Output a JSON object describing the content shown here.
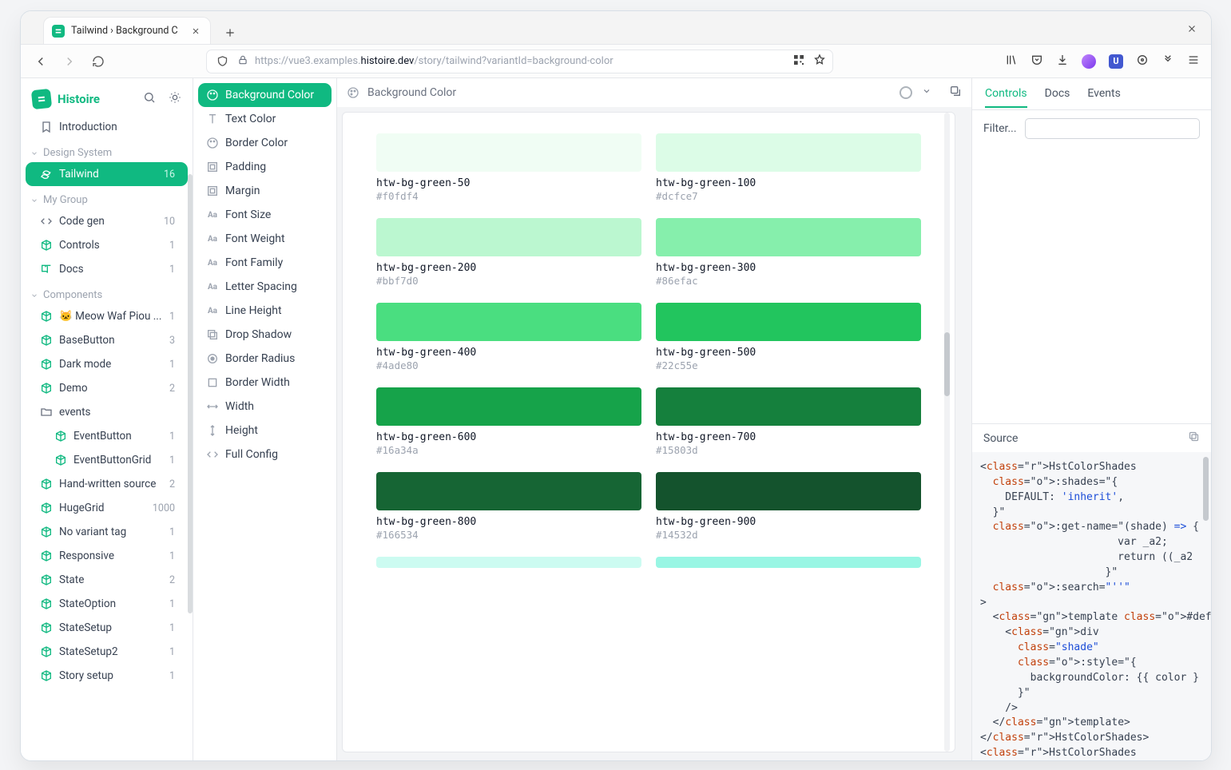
{
  "browser": {
    "tab_title": "Tailwind › Background C",
    "url_prefix": "https://vue3.examples.",
    "url_host": "histoire.dev",
    "url_path": "/story/tailwind?variantId=background-color"
  },
  "sidebar": {
    "brand": "Histoire",
    "intro": "Introduction",
    "groups": {
      "design": "Design System",
      "mygroup": "My Group",
      "components": "Components"
    },
    "design_items": [
      {
        "label": "Tailwind",
        "count": "16",
        "active": true
      }
    ],
    "mygroup_items": [
      {
        "label": "Code gen",
        "count": "10",
        "icon": "code"
      },
      {
        "label": "Controls",
        "count": "1",
        "icon": "cube"
      },
      {
        "label": "Docs",
        "count": "1",
        "icon": "book"
      }
    ],
    "components": [
      {
        "label": "🐱 Meow Waf Piou ...",
        "count": "1",
        "icon": "cube",
        "emoji": true
      },
      {
        "label": "BaseButton",
        "count": "3",
        "icon": "cube"
      },
      {
        "label": "Dark mode",
        "count": "1",
        "icon": "cube"
      },
      {
        "label": "Demo",
        "count": "2",
        "icon": "cube"
      },
      {
        "label": "events",
        "count": "",
        "icon": "folder",
        "folder": true
      },
      {
        "label": "EventButton",
        "count": "1",
        "icon": "cube",
        "indent": true
      },
      {
        "label": "EventButtonGrid",
        "count": "1",
        "icon": "cube",
        "indent": true
      },
      {
        "label": "Hand-written source",
        "count": "2",
        "icon": "cube"
      },
      {
        "label": "HugeGrid",
        "count": "1000",
        "icon": "cube"
      },
      {
        "label": "No variant tag",
        "count": "1",
        "icon": "cube"
      },
      {
        "label": "Responsive",
        "count": "1",
        "icon": "cube"
      },
      {
        "label": "State",
        "count": "2",
        "icon": "cube"
      },
      {
        "label": "StateOption",
        "count": "1",
        "icon": "cube"
      },
      {
        "label": "StateSetup",
        "count": "1",
        "icon": "cube"
      },
      {
        "label": "StateSetup2",
        "count": "1",
        "icon": "cube"
      },
      {
        "label": "Story setup",
        "count": "1",
        "icon": "cube"
      }
    ]
  },
  "variants": [
    {
      "label": "Background Color",
      "icon": "palette",
      "active": true
    },
    {
      "label": "Text Color",
      "icon": "text"
    },
    {
      "label": "Border Color",
      "icon": "palette"
    },
    {
      "label": "Padding",
      "icon": "box"
    },
    {
      "label": "Margin",
      "icon": "box"
    },
    {
      "label": "Font Size",
      "icon": "aa"
    },
    {
      "label": "Font Weight",
      "icon": "aa"
    },
    {
      "label": "Font Family",
      "icon": "aa"
    },
    {
      "label": "Letter Spacing",
      "icon": "aa"
    },
    {
      "label": "Line Height",
      "icon": "aa"
    },
    {
      "label": "Drop Shadow",
      "icon": "shadow"
    },
    {
      "label": "Border Radius",
      "icon": "circle"
    },
    {
      "label": "Border Width",
      "icon": "square"
    },
    {
      "label": "Width",
      "icon": "harrow"
    },
    {
      "label": "Height",
      "icon": "varrow"
    },
    {
      "label": "Full Config",
      "icon": "code"
    }
  ],
  "crumb": {
    "title": "Background Color"
  },
  "swatches": [
    {
      "name": "htw-bg-green-50",
      "hex": "#f0fdf4",
      "color": "#f0fdf4"
    },
    {
      "name": "htw-bg-green-100",
      "hex": "#dcfce7",
      "color": "#dcfce7"
    },
    {
      "name": "htw-bg-green-200",
      "hex": "#bbf7d0",
      "color": "#bbf7d0"
    },
    {
      "name": "htw-bg-green-300",
      "hex": "#86efac",
      "color": "#86efac"
    },
    {
      "name": "htw-bg-green-400",
      "hex": "#4ade80",
      "color": "#4ade80"
    },
    {
      "name": "htw-bg-green-500",
      "hex": "#22c55e",
      "color": "#22c55e"
    },
    {
      "name": "htw-bg-green-600",
      "hex": "#16a34a",
      "color": "#16a34a"
    },
    {
      "name": "htw-bg-green-700",
      "hex": "#15803d",
      "color": "#15803d"
    },
    {
      "name": "htw-bg-green-800",
      "hex": "#166534",
      "color": "#166534"
    },
    {
      "name": "htw-bg-green-900",
      "hex": "#14532d",
      "color": "#14532d"
    }
  ],
  "rpanel": {
    "tabs": {
      "controls": "Controls",
      "docs": "Docs",
      "events": "Events"
    },
    "filter_label": "Filter...",
    "filter_value": "",
    "source_label": "Source"
  },
  "source_code": "<HstColorShades\n  :shades=\"{\n    DEFAULT: 'inherit',\n  }\"\n  :get-name=\"(shade) => {\n                      var _a2;\n                      return ((_a2\n                    }\"\n  :search=\"''\"\n>\n  <template #default=\"{ color }\">\n    <div\n      class=\"shade\"\n      :style=\"{\n        backgroundColor: {{ color }\n      }\"\n    />\n  </template>\n</HstColorShades>\n<HstColorShades"
}
